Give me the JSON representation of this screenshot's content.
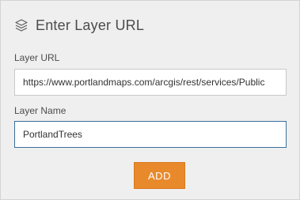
{
  "panel": {
    "title": "Enter Layer URL",
    "icon": "layers-icon"
  },
  "layer_url": {
    "label": "Layer URL",
    "value": "https://www.portlandmaps.com/arcgis/rest/services/Public"
  },
  "layer_name": {
    "label": "Layer Name",
    "value": "PortlandTrees"
  },
  "add_button": {
    "label": "ADD"
  },
  "colors": {
    "panel_background": "#efefef",
    "accent_button": "#e8892b",
    "focused_border": "#3c6f9a",
    "text": "#4c4c4c"
  }
}
